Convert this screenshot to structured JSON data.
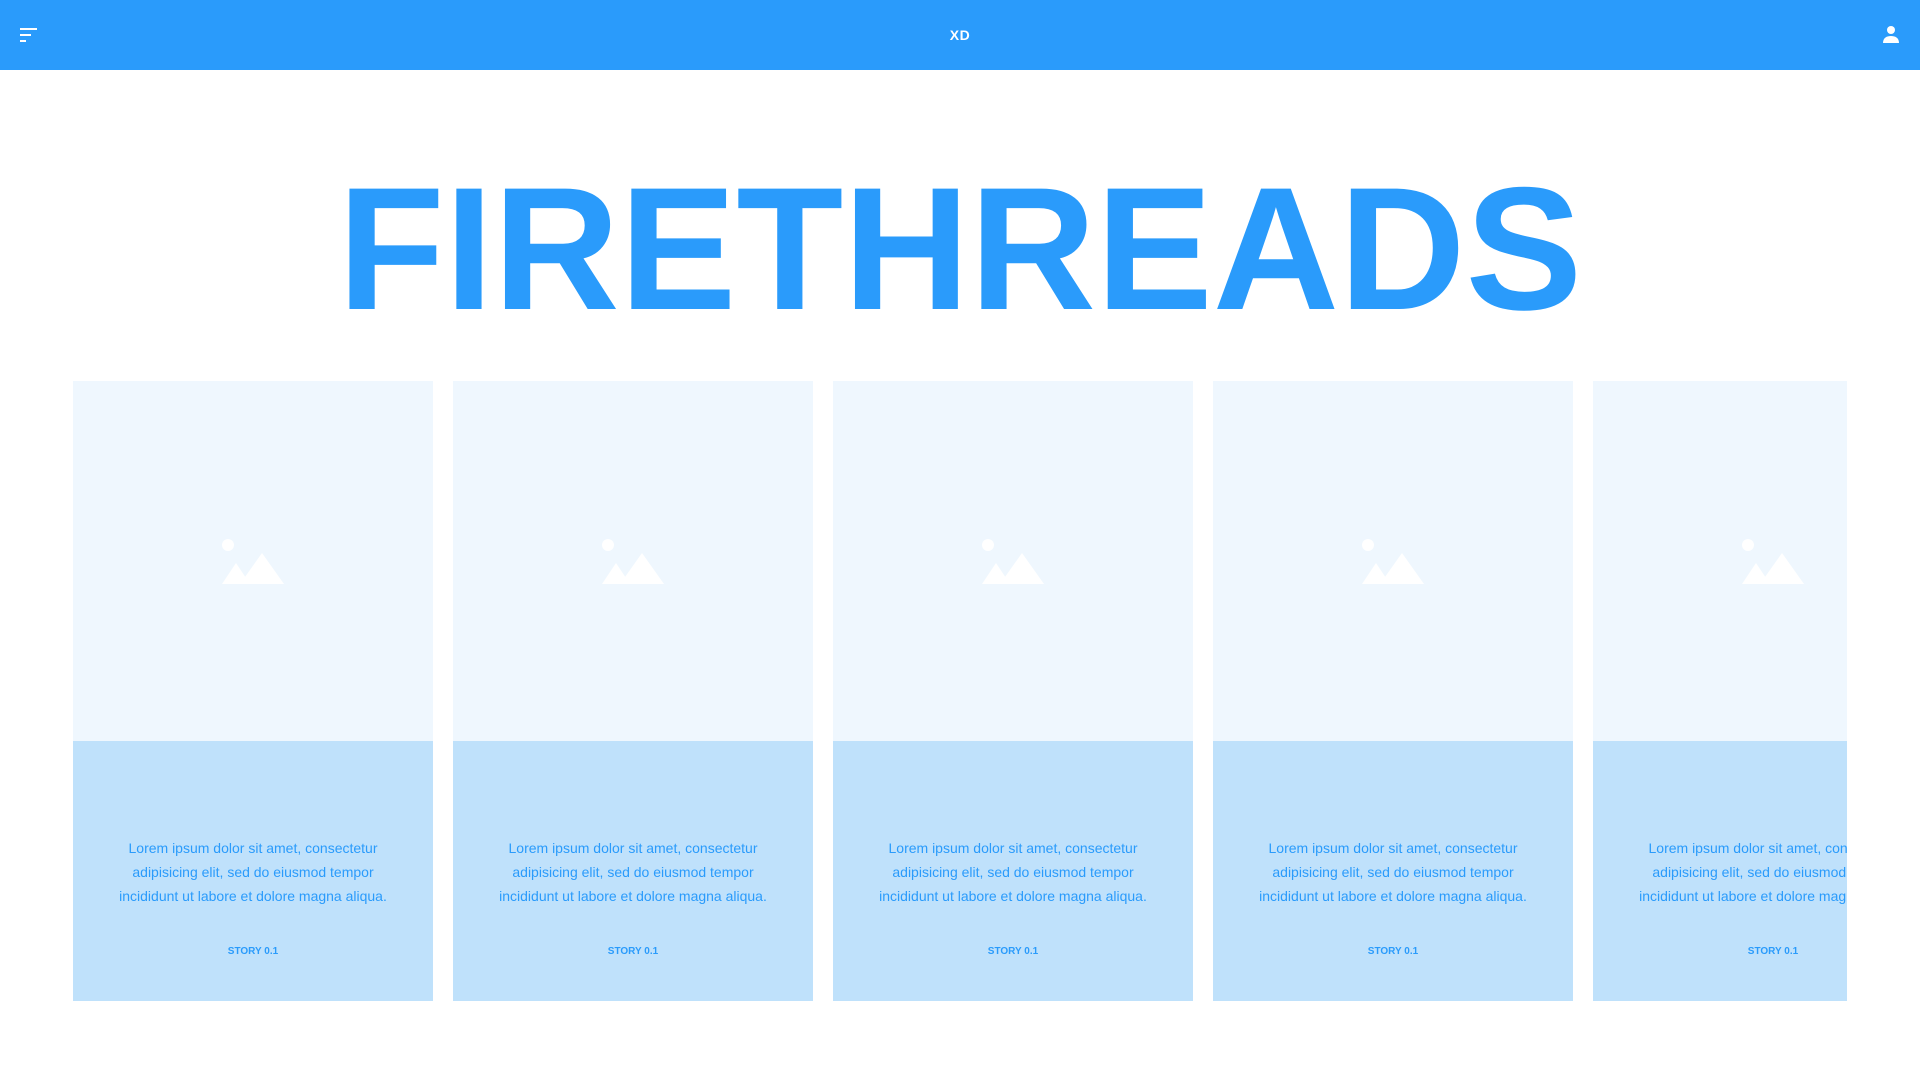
{
  "header": {
    "brand": "XD",
    "menu_icon": "menu-icon",
    "user_icon": "user-icon",
    "background_color": "#2a9bfb"
  },
  "hero": {
    "title": "FIRETHREADS",
    "color": "#2a9bfb"
  },
  "cards": [
    {
      "image_icon": "image-placeholder-icon",
      "text": "Lorem ipsum dolor sit amet, consectetur adipisicing elit, sed do eiusmod tempor incididunt ut labore et dolore magna aliqua.",
      "label": "STORY 0.1"
    },
    {
      "image_icon": "image-placeholder-icon",
      "text": "Lorem ipsum dolor sit amet, consectetur adipisicing elit, sed do eiusmod tempor incididunt ut labore et dolore magna aliqua.",
      "label": "STORY 0.1"
    },
    {
      "image_icon": "image-placeholder-icon",
      "text": "Lorem ipsum dolor sit amet, consectetur adipisicing elit, sed do eiusmod tempor incididunt ut labore et dolore magna aliqua.",
      "label": "STORY 0.1"
    },
    {
      "image_icon": "image-placeholder-icon",
      "text": "Lorem ipsum dolor sit amet, consectetur adipisicing elit, sed do eiusmod tempor incididunt ut labore et dolore magna aliqua.",
      "label": "STORY 0.1"
    },
    {
      "image_icon": "image-placeholder-icon",
      "text": "Lorem ipsum dolor sit amet, consectetur adipisicing elit, sed do eiusmod tempor incididunt ut labore et dolore magna aliqua.",
      "label": "STORY 0.1"
    }
  ],
  "colors": {
    "card_media_bg": "#eff7fe",
    "card_body_bg": "#bfe1fb",
    "accent": "#2a9bfb"
  }
}
